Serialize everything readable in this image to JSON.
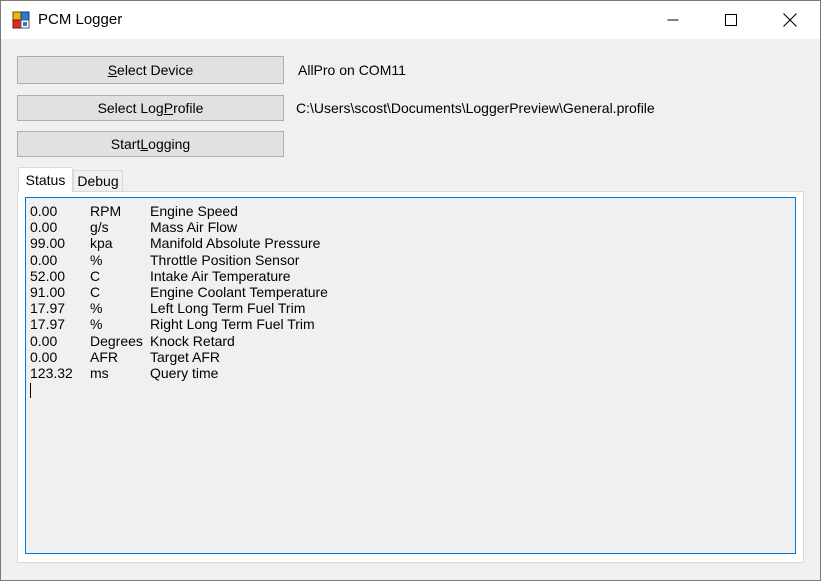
{
  "window": {
    "title": "PCM Logger",
    "icon": "pcm-logger-app-icon"
  },
  "controls": {
    "minimize_icon": "minimize-icon",
    "maximize_icon": "maximize-icon",
    "close_icon": "close-icon"
  },
  "buttons": {
    "select_device": {
      "pre": "",
      "accel": "S",
      "post": "elect Device"
    },
    "select_log_profile": {
      "pre": "Select Log ",
      "accel": "P",
      "post": "rofile"
    },
    "start_logging": {
      "pre": "Start ",
      "accel": "L",
      "post": "ogging"
    }
  },
  "labels": {
    "device": "AllPro on COM11",
    "profile_path": "C:\\Users\\scost\\Documents\\LoggerPreview\\General.profile"
  },
  "tabs": [
    {
      "label": "Status",
      "active": true
    },
    {
      "label": "Debug",
      "active": false
    }
  ],
  "status_rows": [
    {
      "value": "0.00",
      "unit": "RPM",
      "name": "Engine Speed"
    },
    {
      "value": "0.00",
      "unit": "g/s",
      "name": "Mass Air Flow"
    },
    {
      "value": "99.00",
      "unit": "kpa",
      "name": "Manifold Absolute Pressure"
    },
    {
      "value": "0.00",
      "unit": "%",
      "name": "Throttle Position Sensor"
    },
    {
      "value": "52.00",
      "unit": "C",
      "name": "Intake Air Temperature"
    },
    {
      "value": "91.00",
      "unit": "C",
      "name": "Engine Coolant Temperature"
    },
    {
      "value": "17.97",
      "unit": "%",
      "name": "Left Long Term Fuel Trim"
    },
    {
      "value": "17.97",
      "unit": "%",
      "name": "Right Long Term Fuel Trim"
    },
    {
      "value": "0.00",
      "unit": "Degrees",
      "name": "Knock Retard"
    },
    {
      "value": "0.00",
      "unit": "AFR",
      "name": "Target AFR"
    },
    {
      "value": "123.32",
      "unit": "ms",
      "name": "Query time"
    }
  ],
  "colors": {
    "focus_border": "#0078d7",
    "button_face": "#e1e1e1",
    "window_bg": "#f0f0f0"
  }
}
